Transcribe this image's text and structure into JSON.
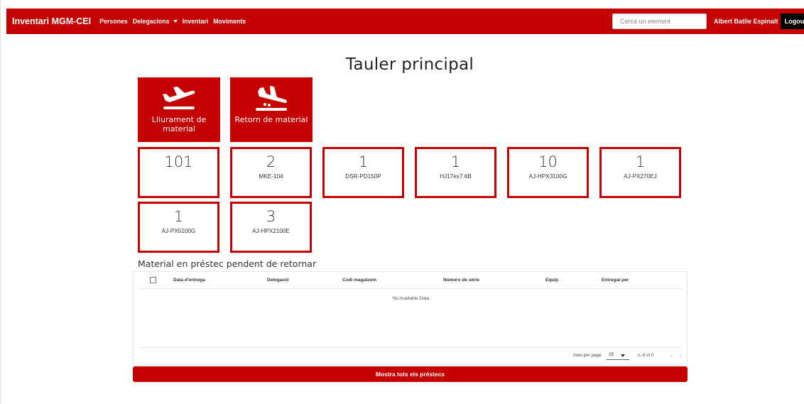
{
  "navbar": {
    "brand": "Inventari MGM-CEI",
    "links": [
      "Persones",
      "Delegacions",
      "Inventari",
      "Moviments"
    ],
    "search_placeholder": "Cerca un element",
    "user": "Albert Batlle Espinalt",
    "logout": "Logout",
    "color": "#c40000"
  },
  "page_title": "Tauler principal",
  "actions": [
    {
      "label": "Lliurament de material",
      "icon": "airplane-takeoff-icon"
    },
    {
      "label": "Retorn de material",
      "icon": "airplane-landing-icon"
    }
  ],
  "stats": [
    {
      "count": "101",
      "label": ""
    },
    {
      "count": "2",
      "label": "MKE-104"
    },
    {
      "count": "1",
      "label": "DSR-PD150P"
    },
    {
      "count": "1",
      "label": "HJ17ex7.6B"
    },
    {
      "count": "10",
      "label": "AJ-HPX3100G"
    },
    {
      "count": "1",
      "label": "AJ-PX270EJ"
    },
    {
      "count": "1",
      "label": "AJ-PX5100G"
    },
    {
      "count": "3",
      "label": "AJ-HPX2100E"
    }
  ],
  "loans": {
    "title": "Material en préstec pendent de retornar",
    "columns": [
      "Data d'entrega",
      "Delegació",
      "Codi magatzem",
      "Número de sèrie",
      "Equip",
      "Entregat per"
    ],
    "rows": [],
    "empty_text": "No Available Data",
    "rows_per_page_label": "rows per page:",
    "rows_per_page": "25",
    "range": "1–0 of 0",
    "show_all": "Mostra tots els préstecs"
  }
}
